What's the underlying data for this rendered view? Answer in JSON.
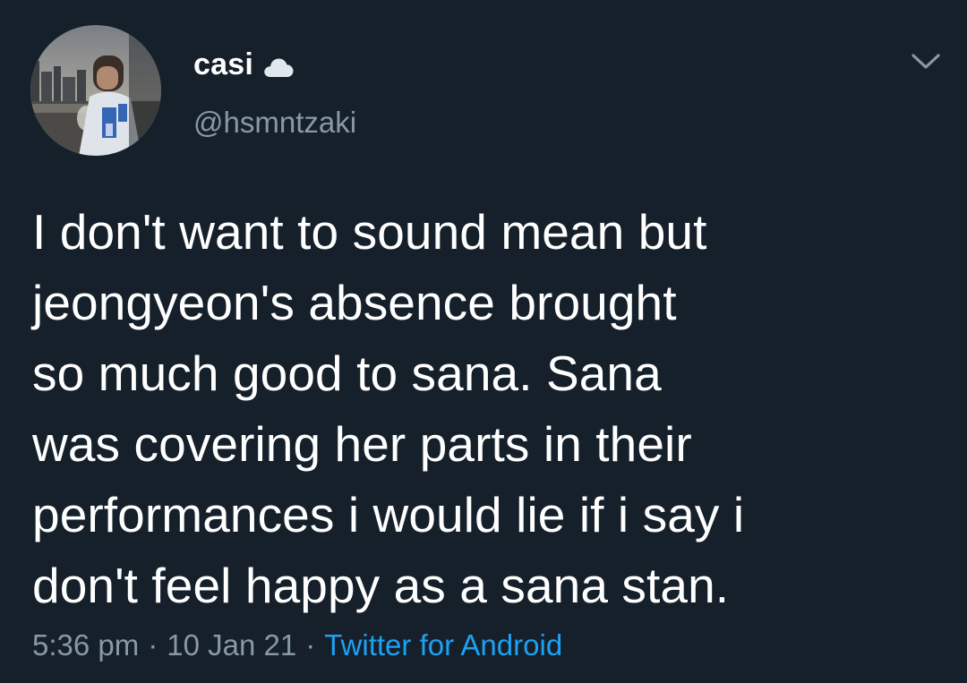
{
  "user": {
    "display_name": "casi",
    "handle": "@hsmntzaki",
    "badge_icon": "cloud-icon"
  },
  "tweet": {
    "text": "I don't want to sound mean but\njeongyeon's absence brought\nso much good to sana. Sana\nwas covering her parts in their\nperformances i would lie if i say i\ndon't feel happy as a sana stan.",
    "time": "5:36 pm",
    "date": "10 Jan 21",
    "separator": "·",
    "source": "Twitter for Android"
  },
  "colors": {
    "background": "#15202b",
    "primary_text": "#ffffff",
    "secondary_text": "#8899a6",
    "link": "#1da1f2"
  }
}
